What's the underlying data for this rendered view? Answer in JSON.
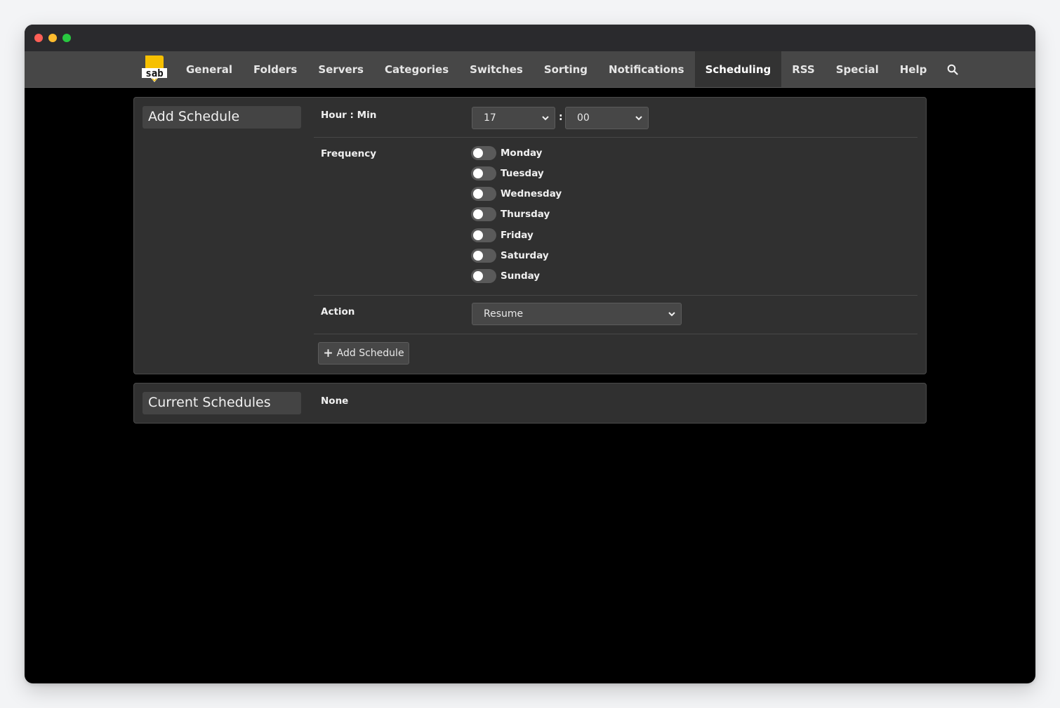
{
  "nav": {
    "logo_text": "sab",
    "items": [
      {
        "label": "General"
      },
      {
        "label": "Folders"
      },
      {
        "label": "Servers"
      },
      {
        "label": "Categories"
      },
      {
        "label": "Switches"
      },
      {
        "label": "Sorting"
      },
      {
        "label": "Notifications"
      },
      {
        "label": "Scheduling",
        "active": true
      },
      {
        "label": "RSS"
      },
      {
        "label": "Special"
      },
      {
        "label": "Help"
      }
    ],
    "search_icon": "search-icon"
  },
  "add_schedule": {
    "title": "Add Schedule",
    "hour_min_label": "Hour : Min",
    "hour_value": "17",
    "colon": ":",
    "minute_value": "00",
    "frequency_label": "Frequency",
    "days": [
      {
        "label": "Monday",
        "on": false
      },
      {
        "label": "Tuesday",
        "on": false
      },
      {
        "label": "Wednesday",
        "on": false
      },
      {
        "label": "Thursday",
        "on": false
      },
      {
        "label": "Friday",
        "on": false
      },
      {
        "label": "Saturday",
        "on": false
      },
      {
        "label": "Sunday",
        "on": false
      }
    ],
    "action_label": "Action",
    "action_value": "Resume",
    "button_label": "Add Schedule"
  },
  "current_schedules": {
    "title": "Current Schedules",
    "value": "None"
  },
  "colors": {
    "accent_logo": "#f6c000",
    "navbar": "#474747",
    "panel": "#303030"
  }
}
